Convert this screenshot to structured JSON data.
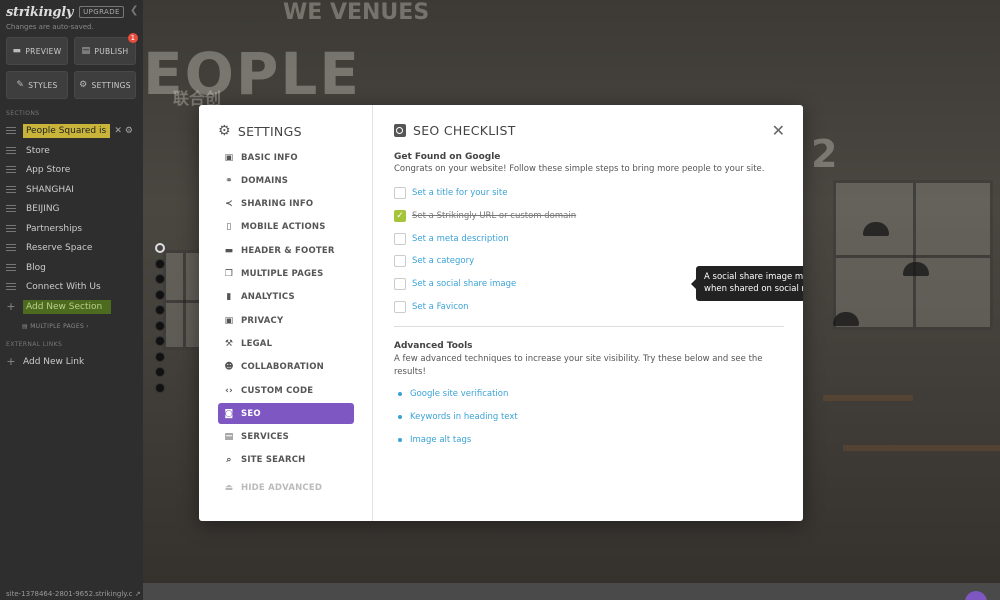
{
  "sidebar": {
    "logo": "strikingly",
    "upgrade": "UPGRADE",
    "autosave": "Changes are auto-saved.",
    "buttons": {
      "preview": "PREVIEW",
      "publish": "PUBLISH",
      "publish_badge": "1",
      "styles": "STYLES",
      "settings": "SETTINGS"
    },
    "sections_heading": "SECTIONS",
    "sections": [
      "People Squared is",
      "Store",
      "App Store",
      "SHANGHAI",
      "BEIJING",
      "Partnerships",
      "Reserve Space",
      "Blog",
      "Connect With Us"
    ],
    "add_section": "Add New Section",
    "multiple_pages": "MULTIPLE PAGES",
    "external_heading": "EXTERNAL LINKS",
    "add_link": "Add New Link",
    "site_url": "site-1378464-2801-9652.strikingly.c"
  },
  "preview": {
    "bg_text": [
      "WE VENUES",
      "EOPLE",
      "联合创",
      "2"
    ],
    "dot_count": 10,
    "active_dot": 0
  },
  "modal": {
    "nav_title": "SETTINGS",
    "nav_items": [
      {
        "label": "BASIC INFO",
        "icon": "briefcase-icon"
      },
      {
        "label": "DOMAINS",
        "icon": "link-icon"
      },
      {
        "label": "SHARING INFO",
        "icon": "share-icon"
      },
      {
        "label": "MOBILE ACTIONS",
        "icon": "mobile-icon"
      },
      {
        "label": "HEADER & FOOTER",
        "icon": "layout-icon"
      },
      {
        "label": "MULTIPLE PAGES",
        "icon": "pages-icon"
      },
      {
        "label": "ANALYTICS",
        "icon": "bar-chart-icon"
      },
      {
        "label": "PRIVACY",
        "icon": "lock-icon"
      },
      {
        "label": "LEGAL",
        "icon": "gavel-icon"
      },
      {
        "label": "COLLABORATION",
        "icon": "users-icon"
      },
      {
        "label": "CUSTOM CODE",
        "icon": "code-icon"
      },
      {
        "label": "SEO",
        "icon": "seo-icon"
      },
      {
        "label": "SERVICES",
        "icon": "services-icon"
      },
      {
        "label": "SITE SEARCH",
        "icon": "search-icon"
      }
    ],
    "active_nav": "SEO",
    "hide_advanced": "HIDE ADVANCED",
    "title": "SEO CHECKLIST",
    "found_heading": "Get Found on Google",
    "found_text": "Congrats on your website! Follow these simple steps to bring more people to your site.",
    "checklist": [
      {
        "label": "Set a title for your site",
        "done": false
      },
      {
        "label": "Set a Strikingly URL or custom domain",
        "done": true
      },
      {
        "label": "Set a meta description",
        "done": false
      },
      {
        "label": "Set a category",
        "done": false
      },
      {
        "label": "Set a social share image",
        "done": false
      },
      {
        "label": "Set a Favicon",
        "done": false
      }
    ],
    "tooltip": "A social share image makes your site more attractive when shared on social media.",
    "advanced_heading": "Advanced Tools",
    "advanced_text": "A few advanced techniques to increase your site visibility. Try these below and see the results!",
    "advanced_links": [
      "Google site verification",
      "Keywords in heading text",
      "Image alt tags"
    ],
    "colors": {
      "accent": "#7e57c2",
      "link": "#3aa2d6",
      "check": "#a5c43a",
      "highlight": "#c9b43a"
    }
  }
}
